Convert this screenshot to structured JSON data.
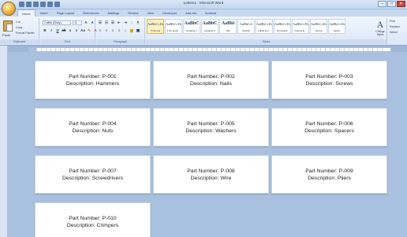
{
  "window": {
    "title": "Letters1 - Microsoft Word",
    "controls": [
      "–",
      "□",
      "✕"
    ]
  },
  "ribbon": {
    "tabs": [
      "Home",
      "Insert",
      "Page Layout",
      "References",
      "Mailings",
      "Review",
      "View",
      "Developer",
      "Add-Ins",
      "Acrobat"
    ],
    "active_tab": "Home",
    "clipboard": {
      "paste_label": "Paste",
      "cut_label": "Cut",
      "copy_label": "Copy",
      "format_painter_label": "Format Painter",
      "group_label": "Clipboard"
    },
    "font": {
      "font_name": "Calibri (Body)",
      "font_size": "11",
      "group_label": "Font"
    },
    "paragraph": {
      "group_label": "Paragraph"
    },
    "styles": {
      "group_label": "Styles",
      "items": [
        {
          "sample": "AaBbCcDc",
          "name": "¶ Normal",
          "big": false,
          "selected": true
        },
        {
          "sample": "AaBbCcDc",
          "name": "¶ No Spaci...",
          "big": false,
          "selected": false
        },
        {
          "sample": "AaBbC",
          "name": "Heading 1",
          "big": true,
          "selected": false
        },
        {
          "sample": "AaBbC",
          "name": "Heading 2",
          "big": true,
          "selected": false
        },
        {
          "sample": "AaBbl",
          "name": "Title",
          "big": true,
          "selected": false
        },
        {
          "sample": "AaBbCcl",
          "name": "Subtitle",
          "big": false,
          "selected": false
        },
        {
          "sample": "AaBbCcDc",
          "name": "Subtle Em...",
          "big": false,
          "selected": false
        },
        {
          "sample": "AaBbCcDc",
          "name": "Emphasis",
          "big": false,
          "selected": false
        },
        {
          "sample": "AaBbCcDc",
          "name": "Intense E...",
          "big": false,
          "selected": false
        },
        {
          "sample": "AaBbCcDc",
          "name": "Strong",
          "big": false,
          "selected": false
        },
        {
          "sample": "AaBbCcDc",
          "name": "Quote",
          "big": false,
          "selected": false
        }
      ],
      "change_styles_label": "Change Styles"
    },
    "editing": {
      "find_label": "Find",
      "replace_label": "Replace",
      "select_label": "Select",
      "group_label": "Editing"
    }
  },
  "labels": [
    {
      "part": "Part Number: P-001",
      "desc": "Description: Hammers"
    },
    {
      "part": "Part Number: P-002",
      "desc": "Description: Nails"
    },
    {
      "part": "Part Number: P-003",
      "desc": "Description: Screws"
    },
    {
      "part": "Part Number: P-004",
      "desc": "Description: Nuts"
    },
    {
      "part": "Part Number: P-005",
      "desc": "Description: Washers"
    },
    {
      "part": "Part Number: P-006",
      "desc": "Description: Spacers"
    },
    {
      "part": "Part Number: P-007",
      "desc": "Description: Screwdrivers"
    },
    {
      "part": "Part Number: P-008",
      "desc": "Description: Wire"
    },
    {
      "part": "Part Number: P-009",
      "desc": "Description: Pliers"
    },
    {
      "part": "Part Number: P-010",
      "desc": "Description: Crimpers"
    }
  ]
}
